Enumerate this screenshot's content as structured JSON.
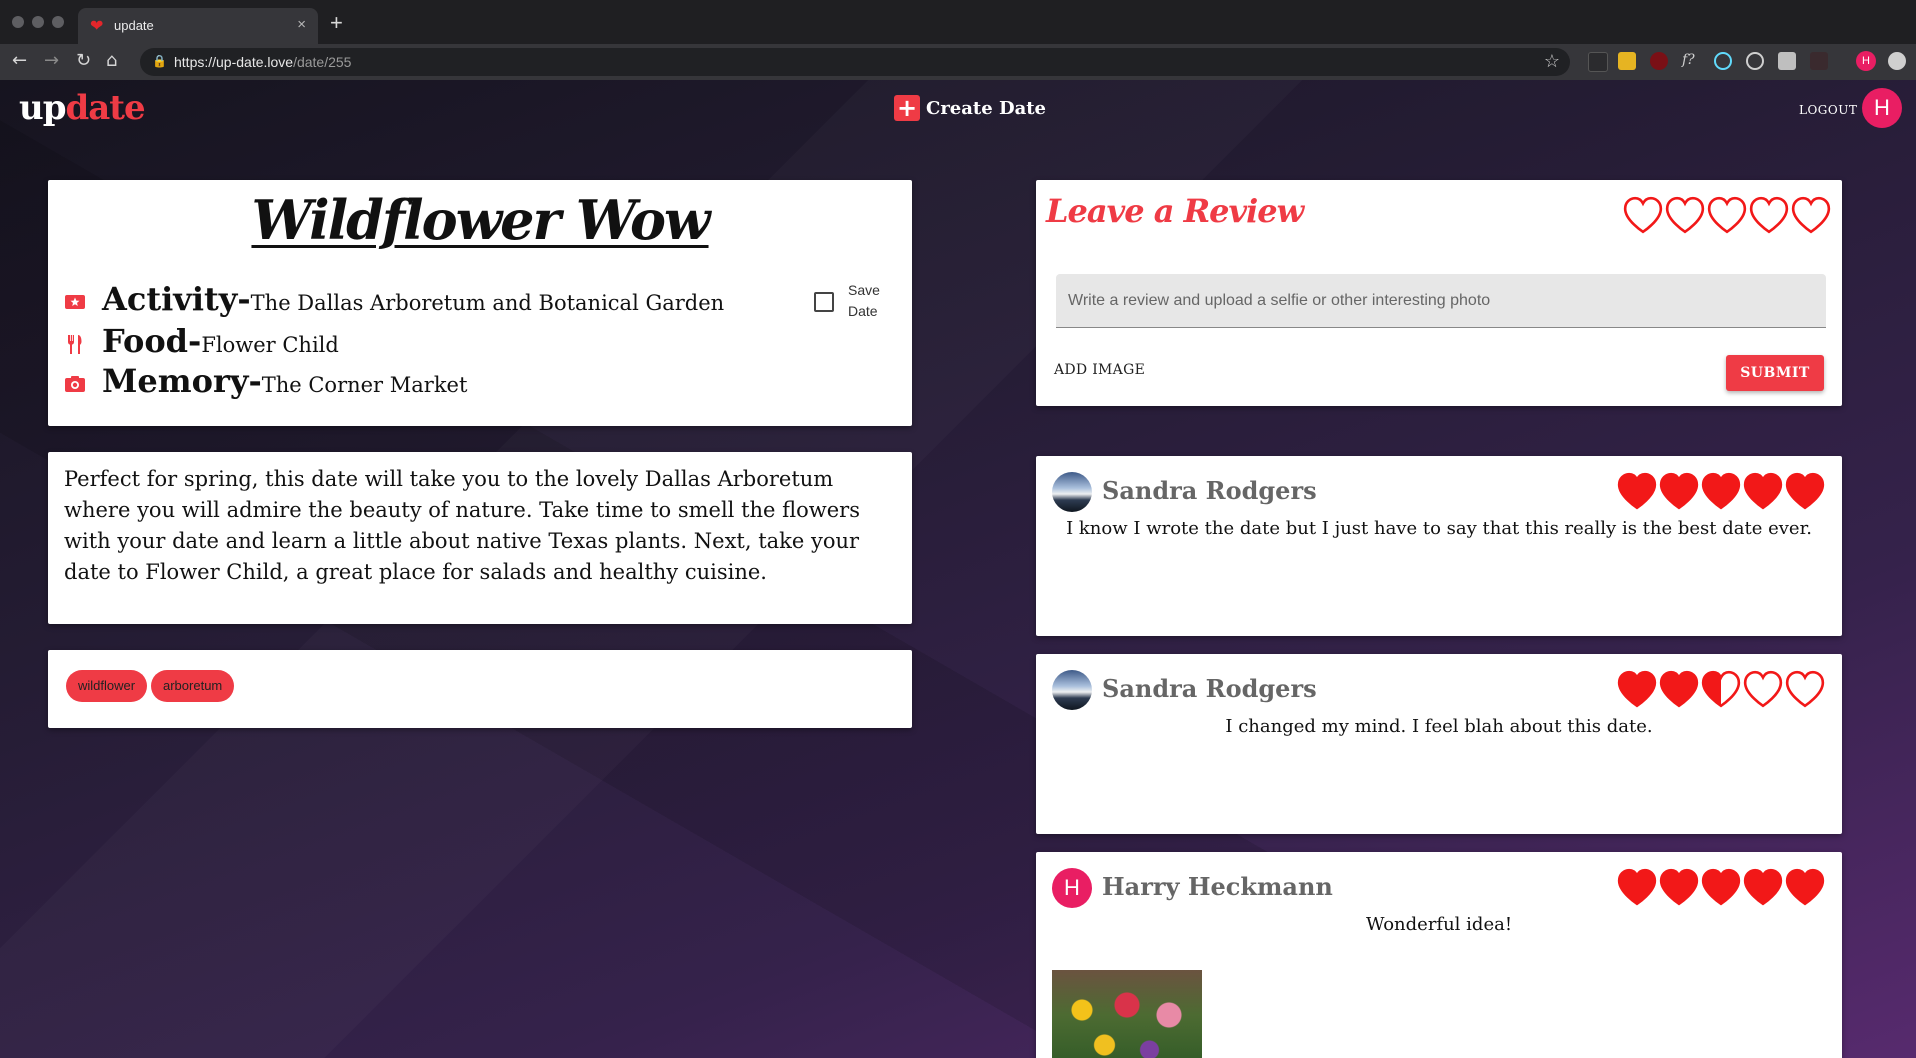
{
  "browser": {
    "tab_title": "update",
    "tab_close": "×",
    "new_tab": "+",
    "url_host": "https://up-date.love",
    "url_path": "/date/255",
    "profile_initial": "H"
  },
  "header": {
    "logo_part1": "up",
    "logo_part2": "date",
    "create_icon": "+",
    "create_label": "Create Date",
    "logout_label": "LOGOUT",
    "user_initial": "H"
  },
  "date": {
    "title": "Wildflower Wow",
    "activity_key": "Activity-",
    "activity_value": "The Dallas Arboretum and Botanical Garden",
    "food_key": "Food-",
    "food_value": "Flower Child",
    "memory_key": "Memory-",
    "memory_value": "The Corner Market",
    "save_label": "Save Date",
    "description": "Perfect for spring, this date will take you to the lovely Dallas Arboretum where you will admire the beauty of nature. Take time to smell the flowers with your date and learn a little about native Texas plants. Next, take your date to Flower Child, a great place for salads and healthy cuisine.",
    "tags": [
      "wildflower",
      "arboretum"
    ]
  },
  "review_form": {
    "heading": "Leave a Review",
    "rating": 0,
    "input_placeholder": "Write a review and upload a selfie or other interesting photo",
    "add_image_label": "ADD IMAGE",
    "submit_label": "SUBMIT"
  },
  "reviews": [
    {
      "author": "Sandra Rodgers",
      "rating": 5,
      "text": "I know I wrote the date but I just have to say that this really is the best date ever.",
      "avatar": "photo"
    },
    {
      "author": "Sandra Rodgers",
      "rating": 2.5,
      "text": "I changed my mind. I feel blah about this date.",
      "avatar": "photo"
    },
    {
      "author": "Harry Heckmann",
      "rating": 5,
      "text": "Wonderful idea!",
      "avatar_initial": "H",
      "has_image": true
    }
  ],
  "colors": {
    "accent": "#ef3b45",
    "avatar_pink": "#e91e63",
    "heart_fill": "#f21818"
  },
  "icons": {
    "activity": "ticket-icon",
    "food": "fork-knife-icon",
    "memory": "camera-icon"
  }
}
